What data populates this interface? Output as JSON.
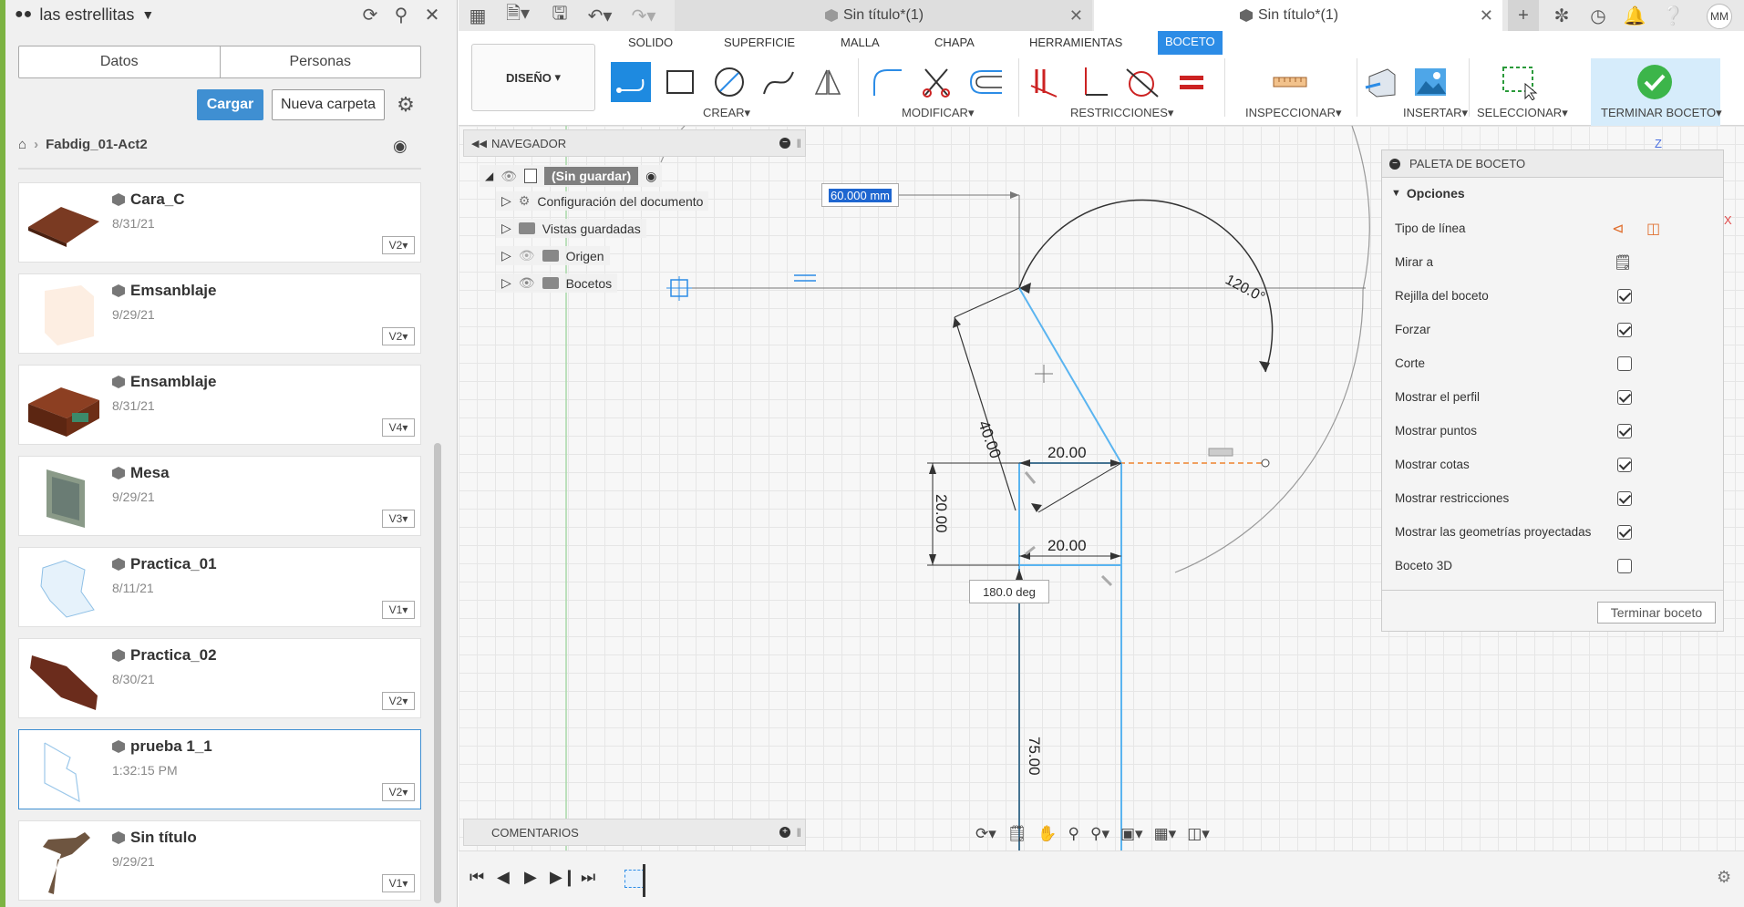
{
  "left_panel": {
    "project": "las estrellitas",
    "tabs": [
      "Datos",
      "Personas"
    ],
    "load_button": "Cargar",
    "new_folder_button": "Nueva carpeta",
    "breadcrumb": "Fabdig_01-Act2",
    "files": [
      {
        "name": "Cara_C",
        "date": "8/31/21",
        "version": "V2"
      },
      {
        "name": "Emsanblaje",
        "date": "9/29/21",
        "version": "V2"
      },
      {
        "name": "Ensamblaje",
        "date": "8/31/21",
        "version": "V4"
      },
      {
        "name": "Mesa",
        "date": "9/29/21",
        "version": "V3"
      },
      {
        "name": "Practica_01",
        "date": "8/11/21",
        "version": "V1"
      },
      {
        "name": "Practica_02",
        "date": "8/30/21",
        "version": "V2"
      },
      {
        "name": "prueba 1_1",
        "date": "1:32:15 PM",
        "version": "V2"
      },
      {
        "name": "Sin título",
        "date": "9/29/21",
        "version": "V1"
      }
    ]
  },
  "tabs": {
    "inactive": "Sin título*(1)",
    "active": "Sin título*(1)",
    "avatar": "MM"
  },
  "ribbon": {
    "workspace": "DISEÑO",
    "tabs": [
      "SOLIDO",
      "SUPERFICIE",
      "MALLA",
      "CHAPA",
      "HERRAMIENTAS",
      "BOCETO"
    ],
    "groups": [
      "CREAR",
      "MODIFICAR",
      "RESTRICCIONES",
      "INSPECCIONAR",
      "INSERTAR",
      "SELECCIONAR",
      "TERMINAR BOCETO"
    ]
  },
  "browser": {
    "title": "NAVEGADOR",
    "root": "(Sin guardar)",
    "items": [
      "Configuración del documento",
      "Vistas guardadas",
      "Origen",
      "Bocetos"
    ]
  },
  "sketch": {
    "input_value": "60.000 mm",
    "angle_label": "120.0°",
    "dim_40": "40.00",
    "dim_20a": "20.00",
    "dim_20b": "20.00",
    "dim_20c": "20.00",
    "dim_75": "75.00",
    "deg_box": "180.0 deg"
  },
  "palette": {
    "title": "PALETA DE BOCETO",
    "section": "Opciones",
    "rows": [
      {
        "label": "Tipo de línea",
        "type": "icons"
      },
      {
        "label": "Mirar a",
        "type": "icon"
      },
      {
        "label": "Rejilla del boceto",
        "checked": true
      },
      {
        "label": "Forzar",
        "checked": true
      },
      {
        "label": "Corte",
        "checked": false
      },
      {
        "label": "Mostrar el perfil",
        "checked": true
      },
      {
        "label": "Mostrar puntos",
        "checked": true
      },
      {
        "label": "Mostrar cotas",
        "checked": true
      },
      {
        "label": "Mostrar restricciones",
        "checked": true
      },
      {
        "label": "Mostrar las geometrías proyectadas",
        "checked": true
      },
      {
        "label": "Boceto 3D",
        "checked": false
      }
    ],
    "finish_button": "Terminar boceto"
  },
  "comments": "COMENTARIOS",
  "axis_labels": {
    "z": "Z",
    "x": "X"
  }
}
